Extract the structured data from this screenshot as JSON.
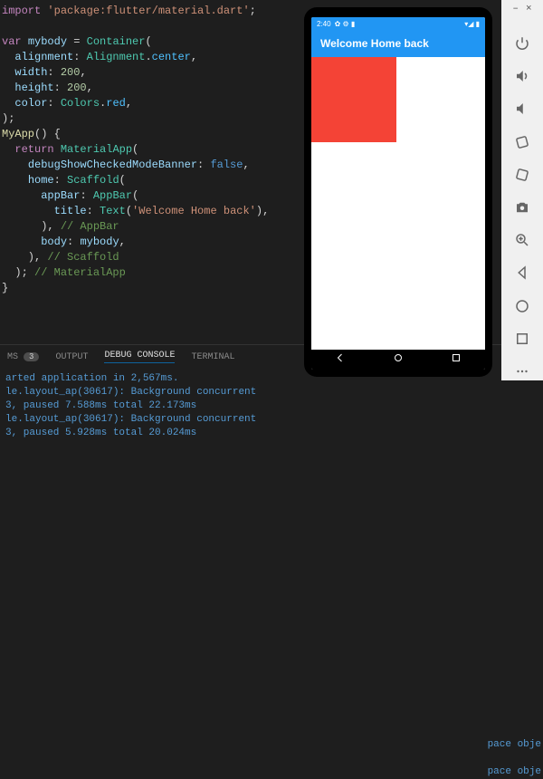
{
  "code": {
    "import_kw": "import",
    "import_str": "'package:flutter/material.dart'",
    "var_kw": "var",
    "mybody": "mybody",
    "container": "Container",
    "alignment": "alignment",
    "alignment_class": "Alignment",
    "alignment_val": "center",
    "width": "width",
    "width_val": "200",
    "height": "height",
    "height_val": "200",
    "color": "color",
    "colors_class": "Colors",
    "colors_val": "red",
    "myapp": "MyApp",
    "return_kw": "return",
    "materialapp": "MaterialApp",
    "debugbanner": "debugShowCheckedModeBanner",
    "false_val": "false",
    "home": "home",
    "scaffold": "Scaffold",
    "appbar_prop": "appBar",
    "appbar_cls": "AppBar",
    "title": "title",
    "text_cls": "Text",
    "title_str": "'Welcome Home back'",
    "appbar_cmt": "// AppBar",
    "body_prop": "body",
    "scaffold_cmt": "// Scaffold",
    "materialapp_cmt": "// MaterialApp"
  },
  "bottom": {
    "problems_label": "MS",
    "problems_count": "3",
    "output_label": "OUTPUT",
    "debug_label": "DEBUG CONSOLE",
    "terminal_label": "TERMINAL"
  },
  "console": {
    "line1": "arted application in 2,567ms.",
    "line2": "le.layout_ap(30617): Background concurrent",
    "line3": "3, paused 7.588ms total 22.173ms",
    "line4": "le.layout_ap(30617): Background concurrent",
    "line5": "3, paused 5.928ms total 20.024ms",
    "right1": "pace obje",
    "right2": "pace obje"
  },
  "device": {
    "time": "2:40",
    "status_icons": "✿ ⚙ ▮",
    "signal_icons": "▾◢ ▮",
    "appbar_title": "Welcome Home back",
    "box_color": "#F44336"
  },
  "emutools": {
    "minimize": "–",
    "close": "×"
  }
}
